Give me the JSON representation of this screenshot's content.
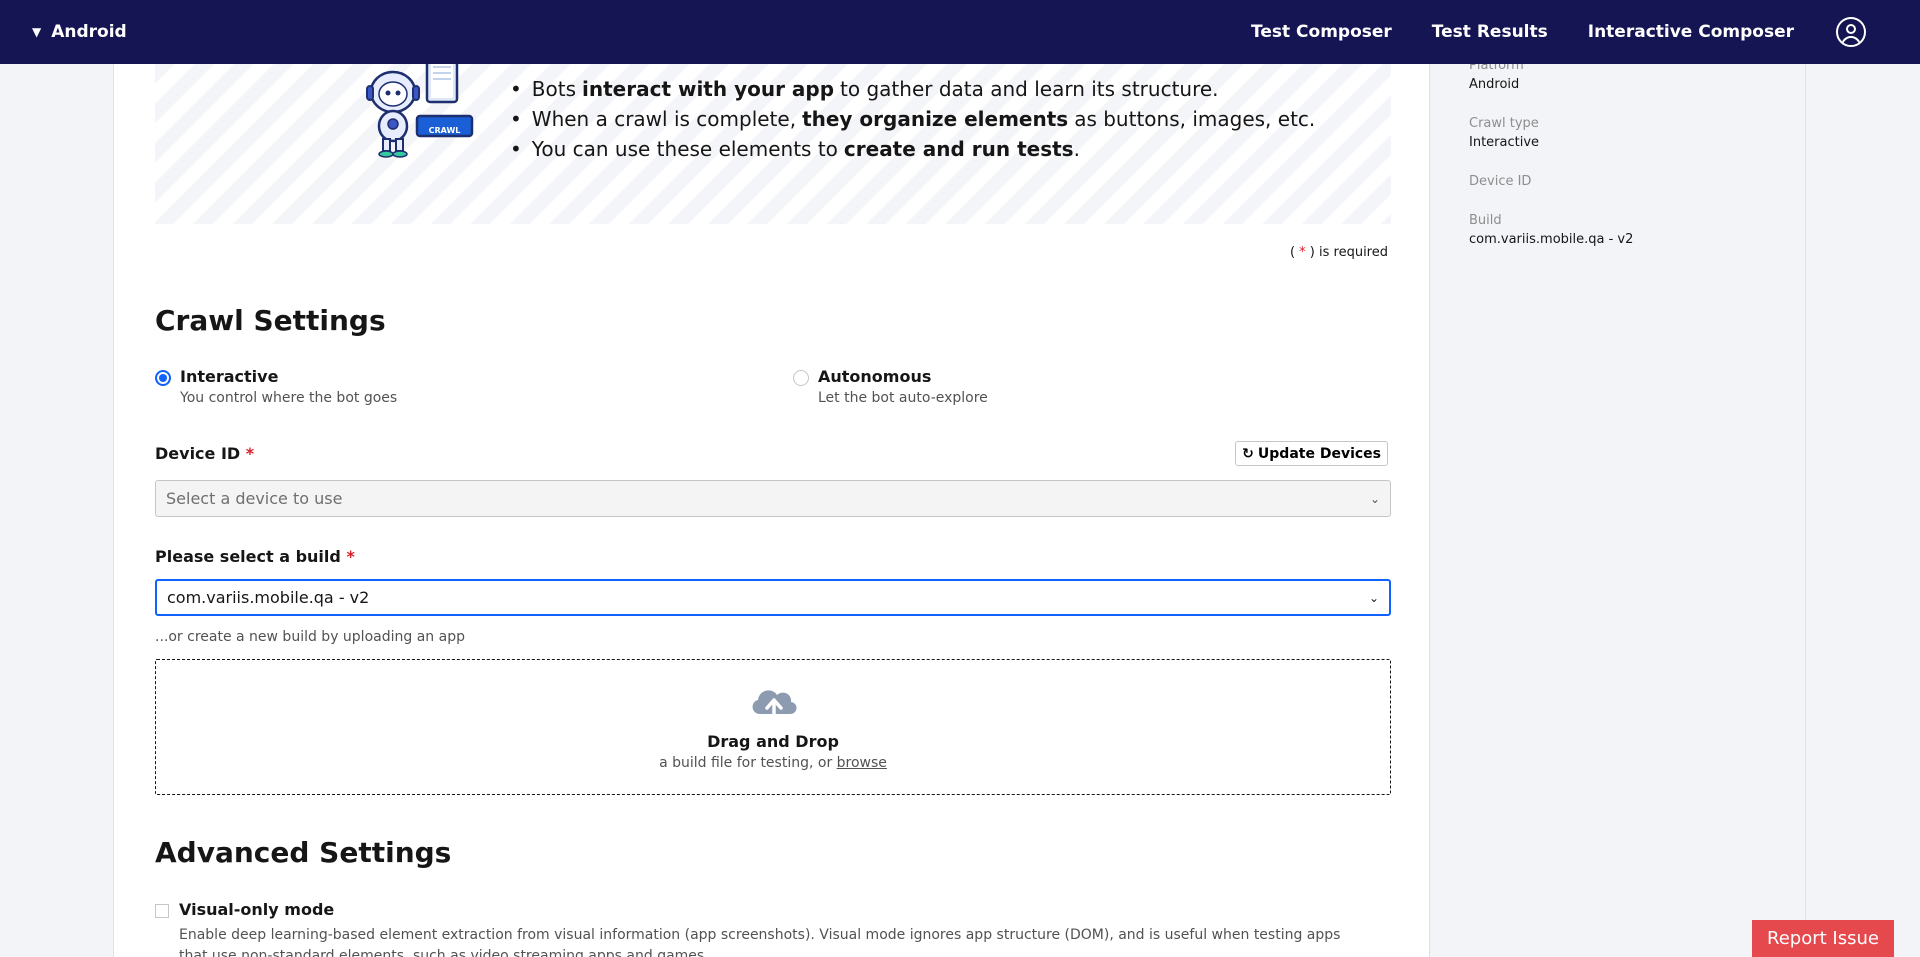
{
  "header": {
    "project": "Android",
    "nav": [
      "Test Composer",
      "Test Results",
      "Interactive Composer"
    ]
  },
  "banner": {
    "robot_label": "CRAWL",
    "bullets": [
      {
        "pre": "Bots",
        "bold": "interact with your app",
        "post": "to gather data and learn its structure."
      },
      {
        "pre": "When a crawl is complete,",
        "bold": "they organize elements",
        "post": "as buttons, images, etc."
      },
      {
        "pre": "You can use these elements to",
        "bold": "create and run tests",
        "post": "."
      }
    ]
  },
  "required_note": {
    "open": "(",
    "star": "*",
    "close": ") is required"
  },
  "crawl_settings": {
    "title": "Crawl Settings",
    "options": [
      {
        "label": "Interactive",
        "sub": "You control where the bot goes",
        "checked": true
      },
      {
        "label": "Autonomous",
        "sub": "Let the bot auto-explore",
        "checked": false
      }
    ],
    "device_label": "Device ID",
    "update_devices": "Update Devices",
    "device_placeholder": "Select a device to use",
    "build_label": "Please select a build",
    "build_value": "com.variis.mobile.qa - v2",
    "build_helper": "...or create a new build by uploading an app",
    "drop_title": "Drag and Drop",
    "drop_sub": "a build file for testing, or",
    "drop_link": "browse"
  },
  "advanced": {
    "title": "Advanced Settings",
    "visual_label": "Visual-only mode",
    "visual_desc": "Enable deep learning-based element extraction from visual information (app screenshots). Visual mode ignores app structure (DOM), and is useful when testing apps that use non-standard elements, such as video streaming apps and games."
  },
  "summary": {
    "platform_label": "Platform",
    "platform_value": "Android",
    "crawl_type_label": "Crawl type",
    "crawl_type_value": "Interactive",
    "device_label": "Device ID",
    "build_label": "Build",
    "build_value": "com.variis.mobile.qa - v2"
  },
  "report_issue": "Report Issue",
  "colors": {
    "topbar": "#141552",
    "accent": "#0f62fe",
    "required": "#da1e28",
    "report": "#e5484d"
  }
}
